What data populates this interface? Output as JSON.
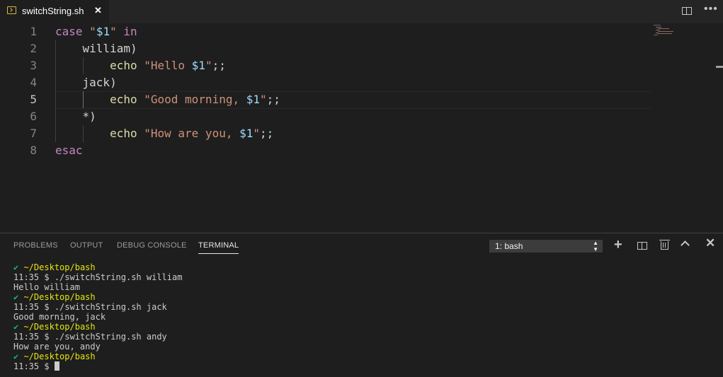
{
  "tab": {
    "filename": "switchString.sh",
    "close": "✕"
  },
  "editor": {
    "line_numbers": [
      "1",
      "2",
      "3",
      "4",
      "5",
      "6",
      "7",
      "8"
    ],
    "active_line": "5"
  },
  "code": {
    "l1": {
      "kw": "case",
      "str_open": "\"",
      "var": "$1",
      "str_close": "\"",
      "kw2": "in"
    },
    "l2": {
      "text": "william)"
    },
    "l3": {
      "cmd": "echo",
      "str": "\"Hello ",
      "var": "$1",
      "str_close": "\"",
      "tail": ";;"
    },
    "l4": {
      "text": "jack)"
    },
    "l5": {
      "cmd": "echo",
      "str": "\"Good morning, ",
      "var": "$1",
      "str_close": "\"",
      "tail": ";;"
    },
    "l6": {
      "text": "*)"
    },
    "l7": {
      "cmd": "echo",
      "str": "\"How are you, ",
      "var": "$1",
      "str_close": "\"",
      "tail": ";;"
    },
    "l8": {
      "kw": "esac"
    }
  },
  "panel": {
    "tabs": [
      "PROBLEMS",
      "OUTPUT",
      "DEBUG CONSOLE",
      "TERMINAL"
    ],
    "active_tab": "TERMINAL",
    "terminal_select": "1: bash"
  },
  "terminal": {
    "check": "✔",
    "path": "~/Desktop/bash",
    "prompt_time": "11:35",
    "prompt_symbol": "$",
    "commands": [
      {
        "cmd": "./switchString.sh william",
        "output": "Hello william"
      },
      {
        "cmd": "./switchString.sh jack",
        "output": "Good morning, jack"
      },
      {
        "cmd": "./switchString.sh andy",
        "output": "How are you, andy"
      }
    ]
  },
  "colors": {
    "keyword": "#c586c0",
    "string": "#ce9178",
    "variable": "#9cdcfe",
    "command": "#dcdcaa",
    "terminal_path": "#e5e510",
    "terminal_check": "#0dbc79"
  }
}
